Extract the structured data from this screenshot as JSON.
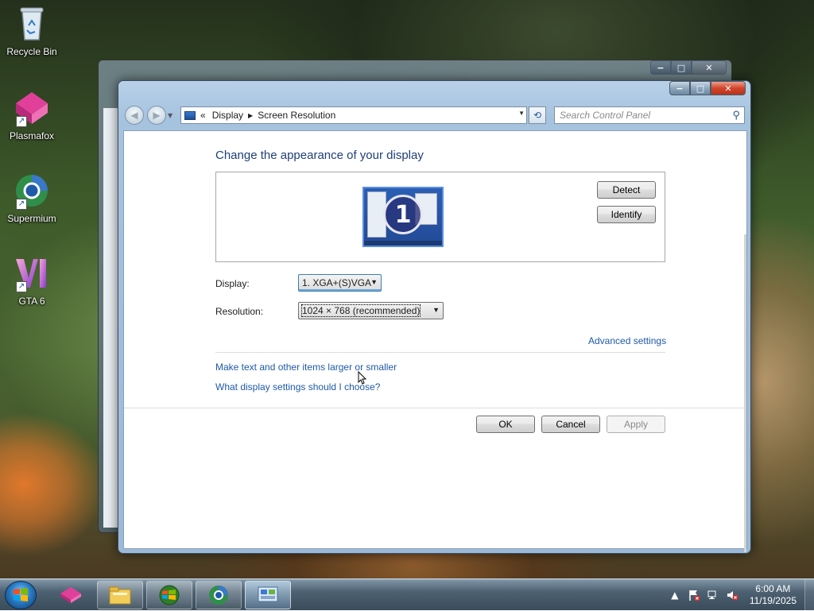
{
  "desktop": {
    "icons": [
      {
        "label": "Recycle Bin"
      },
      {
        "label": "Plasmafox"
      },
      {
        "label": "Supermium"
      },
      {
        "label": "GTA 6"
      }
    ]
  },
  "window": {
    "caption_buttons": {
      "minimize": "−",
      "maximize": "□",
      "close": "✕"
    },
    "address": {
      "prefix": "«",
      "crumbs": [
        "Display",
        "Screen Resolution"
      ]
    },
    "search_placeholder": "Search Control Panel",
    "heading": "Change the appearance of your display",
    "monitor_number": "1",
    "detect_label": "Detect",
    "identify_label": "Identify",
    "display_label": "Display:",
    "display_value": "1. XGA+(S)VGA",
    "resolution_label": "Resolution:",
    "resolution_value": "1024 × 768 (recommended)",
    "advanced_link": "Advanced settings",
    "link_text_size": "Make text and other items larger or smaller",
    "link_help": "What display settings should I choose?",
    "ok_label": "OK",
    "cancel_label": "Cancel",
    "apply_label": "Apply"
  },
  "taskbar": {
    "pinned": [
      "plasmafox-icon",
      "windows-explorer-icon",
      "windows-media-player-icon",
      "supermium-icon",
      "control-panel-icon"
    ],
    "clock_time": "6:00 AM",
    "clock_date": "11/19/2025"
  },
  "colors": {
    "heading": "#1e3f78",
    "link": "#1e5aa8"
  }
}
